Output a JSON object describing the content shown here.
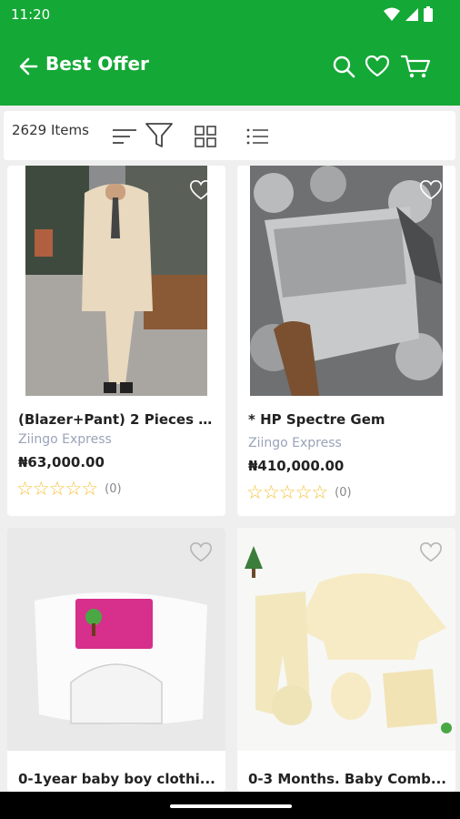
{
  "status": {
    "time": "11:20"
  },
  "header": {
    "title": "Best Offer"
  },
  "toolbar": {
    "items_count": "2629 Items"
  },
  "products": [
    {
      "name": "(Blazer+Pant) 2 Pieces D...",
      "seller": "Ziingo Express",
      "price": "₦63,000.00",
      "rating_count": "(0)"
    },
    {
      "name": "* HP Spectre Gem",
      "seller": "Ziingo Express",
      "price": "₦410,000.00",
      "rating_count": "(0)"
    },
    {
      "name": "0-1year baby boy clothi..."
    },
    {
      "name": "0-3 Months. Baby Comb..."
    }
  ],
  "colors": {
    "brand": "#14a836",
    "star": "#f3c233",
    "seller": "#9aa3b8"
  },
  "icons": [
    "back-arrow-icon",
    "search-icon",
    "heart-icon",
    "cart-icon",
    "sort-icon",
    "filter-icon",
    "grid-view-icon",
    "list-view-icon",
    "favorite-icon",
    "star-icon"
  ]
}
